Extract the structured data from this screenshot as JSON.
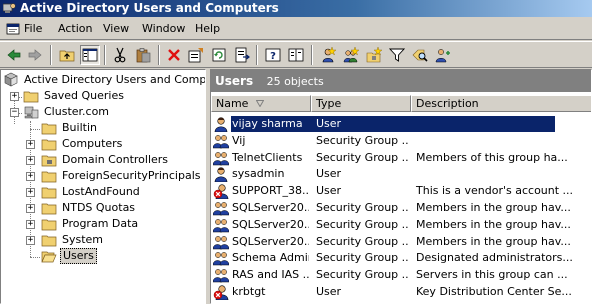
{
  "window": {
    "title": "Active Directory Users and Computers"
  },
  "menu": [
    {
      "label": "File"
    },
    {
      "label": "Action"
    },
    {
      "label": "View"
    },
    {
      "label": "Window"
    },
    {
      "label": "Help"
    }
  ],
  "toolbar": {
    "buttons": [
      "back-icon",
      "forward-icon",
      "up-icon",
      "show-hide-tree-icon",
      "cut-icon",
      "paste-icon",
      "delete-icon",
      "properties-icon",
      "refresh-icon",
      "export-list-icon",
      "help-icon",
      "help-topics-icon",
      "new-user-icon",
      "new-group-icon",
      "new-ou-icon",
      "filter-icon",
      "find-icon",
      "add-to-group-icon"
    ]
  },
  "tree": {
    "root": "Active Directory Users and Computer",
    "saved_queries": "Saved Queries",
    "domain": "Cluster.com",
    "children": [
      "Builtin",
      "Computers",
      "Domain Controllers",
      "ForeignSecurityPrincipals",
      "LostAndFound",
      "NTDS Quotas",
      "Program Data",
      "System",
      "Users"
    ]
  },
  "right_pane": {
    "title": "Users",
    "count": "25 objects",
    "columns": {
      "name": "Name",
      "type": "Type",
      "description": "Description"
    },
    "rows": [
      {
        "name": "vijay sharma",
        "type": "User",
        "description": "",
        "icon": "user-icon"
      },
      {
        "name": "Vij",
        "type": "Security Group ...",
        "description": "",
        "icon": "group-icon"
      },
      {
        "name": "TelnetClients",
        "type": "Security Group ...",
        "description": "Members of this group ha...",
        "icon": "group-icon"
      },
      {
        "name": "sysadmin",
        "type": "User",
        "description": "",
        "icon": "user-icon"
      },
      {
        "name": "SUPPORT_38...",
        "type": "User",
        "description": "This is a vendor's account ...",
        "icon": "disabled-user-icon"
      },
      {
        "name": "SQLServer20...",
        "type": "Security Group ...",
        "description": "Members in the group hav...",
        "icon": "group-icon"
      },
      {
        "name": "SQLServer20...",
        "type": "Security Group ...",
        "description": "Members in the group hav...",
        "icon": "group-icon"
      },
      {
        "name": "SQLServer20...",
        "type": "Security Group ...",
        "description": "Members in the group hav...",
        "icon": "group-icon"
      },
      {
        "name": "Schema Admins",
        "type": "Security Group ...",
        "description": "Designated administrators...",
        "icon": "group-icon"
      },
      {
        "name": "RAS and IAS ...",
        "type": "Security Group ...",
        "description": "Servers in this group can ...",
        "icon": "group-icon"
      },
      {
        "name": "krbtgt",
        "type": "User",
        "description": "Key Distribution Center Se...",
        "icon": "disabled-user-icon"
      }
    ]
  }
}
